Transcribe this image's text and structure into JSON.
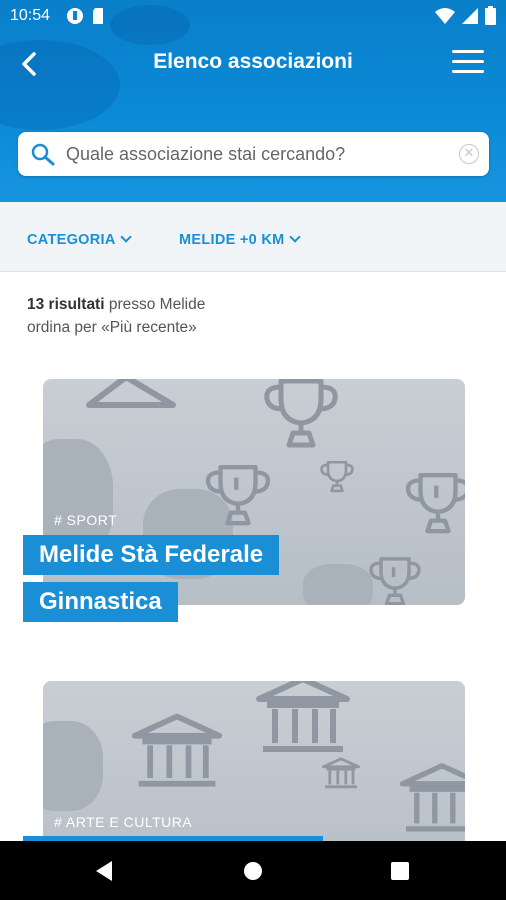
{
  "status_bar": {
    "time": "10:54"
  },
  "header": {
    "title": "Elenco associazioni"
  },
  "search": {
    "placeholder": "Quale associazione stai cercando?",
    "value": ""
  },
  "filters": [
    {
      "label": "CATEGORIA"
    },
    {
      "label": "MELIDE +0 KM"
    }
  ],
  "results": {
    "count": "13 risultati",
    "location_text": " presso Melide",
    "sort_text": "ordina per «Più recente»"
  },
  "cards": [
    {
      "tag": "# SPORT",
      "title_line1": "Melide Stà Federale",
      "title_line2": "Ginnastica",
      "icon": "trophy-icon"
    },
    {
      "tag": "# ARTE E CULTURA",
      "title_line1": "",
      "title_line2": "",
      "icon": "museum-icon"
    }
  ],
  "colors": {
    "accent": "#1b8fd6",
    "header": "#0a84cf",
    "card_bg": "#c3c9cf"
  }
}
